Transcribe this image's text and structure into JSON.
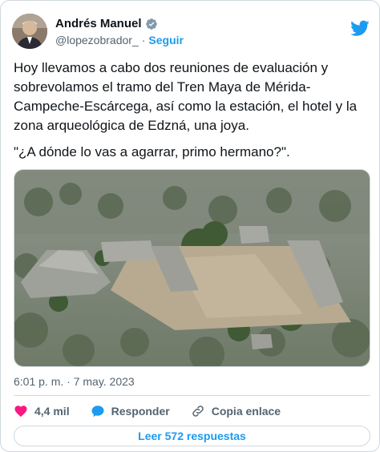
{
  "author": {
    "name": "Andrés Manuel",
    "handle": "@lopezobrador_",
    "separator": "·",
    "follow_label": "Seguir"
  },
  "tweet": {
    "text": "Hoy llevamos a cabo dos reuniones de evaluación y sobrevolamos el tramo del Tren Maya de Mérida-Campeche-Escárcega, así como la estación, el hotel y la zona arqueológica de Edzná, una joya.",
    "quote": "\"¿A dónde lo vas a agarrar, primo hermano?\"."
  },
  "timestamp": "6:01 p. m. · 7 may. 2023",
  "actions": {
    "likes": "4,4 mil",
    "reply_label": "Responder",
    "copy_label": "Copia enlace"
  },
  "replies_button": "Leer 572 respuestas",
  "colors": {
    "accent": "#1d9bf0",
    "like": "#f91880",
    "text": "#0f1419",
    "secondary": "#536471"
  },
  "icons": [
    "verified-badge-icon",
    "twitter-bird-icon",
    "heart-icon",
    "reply-bubble-icon",
    "link-icon"
  ]
}
